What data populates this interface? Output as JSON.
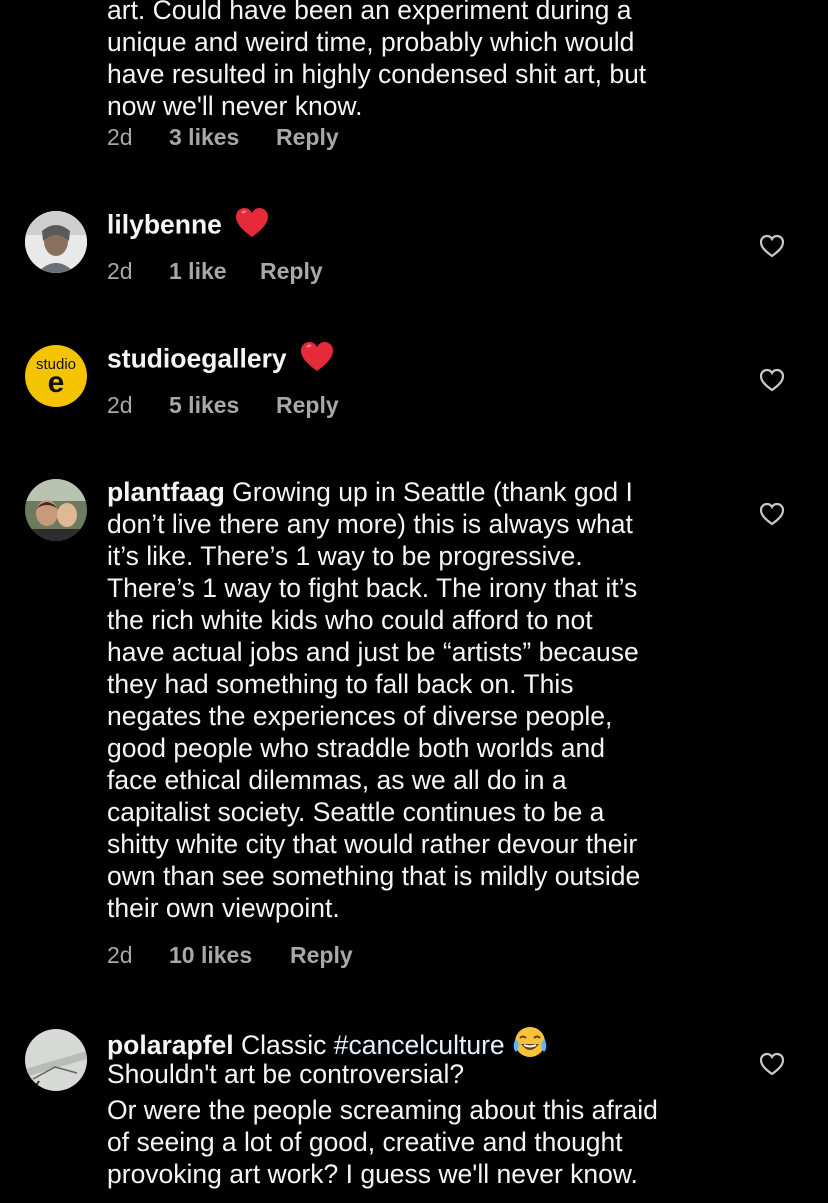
{
  "colors": {
    "background": "#000000",
    "text": "#f5f5f5",
    "meta": "#a8a8a8",
    "hashtag": "#e6f0ff",
    "heart": "#e52a3a"
  },
  "comments": [
    {
      "lines": [
        "art. Could have been an experiment during a",
        "unique and weird time, probably which would",
        "have resulted in highly condensed shit art, but",
        "now we'll never know."
      ],
      "age": "2d",
      "likes": "3 likes",
      "reply": "Reply"
    },
    {
      "username": "lilybenne",
      "emoji": "red-heart",
      "age": "2d",
      "likes": "1 like",
      "reply": "Reply",
      "avatar": "profile-photo"
    },
    {
      "username": "studioegallery",
      "emoji": "red-heart",
      "age": "2d",
      "likes": "5 likes",
      "reply": "Reply",
      "avatar_text": {
        "top": "studio",
        "letter": "e"
      },
      "avatar_color": "#f5c400"
    },
    {
      "username": "plantfaag",
      "lines": [
        "Growing up in Seattle (thank god I",
        "don’t live there any more) this is always what",
        "it’s like. There’s 1 way to be progressive.",
        "There’s 1 way to fight back. The irony that it’s",
        "the rich white kids who could afford to not",
        "have actual jobs and just be “artists” because",
        "they had something to fall back on. This",
        "negates the experiences of diverse people,",
        "good people who straddle both worlds and",
        "face ethical dilemmas, as we all do in a",
        "capitalist society. Seattle continues to be a",
        "shitty white city that would rather devour their",
        "own than see something that is mildly outside",
        "their own viewpoint."
      ],
      "age": "2d",
      "likes": "10 likes",
      "reply": "Reply",
      "avatar": "profile-photo"
    },
    {
      "username": "polarapfel",
      "first_text": "Classic",
      "hashtag": "#cancelculture",
      "emoji": "tears-of-joy",
      "lines": [
        "Shouldn't art be controversial?",
        "Or were the people screaming about this afraid",
        "of seeing a lot of good, creative and thought",
        "provoking art work? I guess we'll never know."
      ],
      "avatar": "profile-photo"
    }
  ]
}
